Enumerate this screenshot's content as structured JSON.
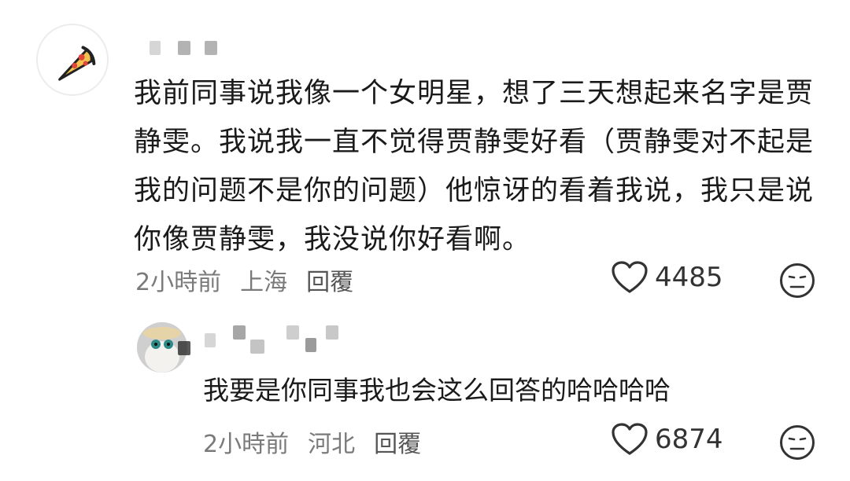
{
  "comment": {
    "text": "我前同事说我像一个女明星，想了三天想起来名字是贾静雯。我说我一直不觉得贾静雯好看（贾静雯对不起是我的问题不是你的问题）他惊讶的看着我说，我只是说你像贾静雯，我没说你好看啊。",
    "time_ago": "2小時前",
    "location": "上海",
    "reply_label": "回覆",
    "likes": "4485"
  },
  "reply": {
    "text": "我要是你同事我也会这么回答的哈哈哈哈",
    "time_ago": "2小時前",
    "location": "河北",
    "reply_label": "回覆",
    "likes": "6874"
  },
  "icons": {
    "main_avatar": "pizza-slice-icon",
    "like": "heart-outline-icon",
    "reaction": "neutral-face-icon"
  },
  "colors": {
    "text": "#1a1a1a",
    "meta": "#7a7a7a",
    "pizza_crust": "#f2c14e",
    "pizza_pepperoni": "#e0463a"
  }
}
